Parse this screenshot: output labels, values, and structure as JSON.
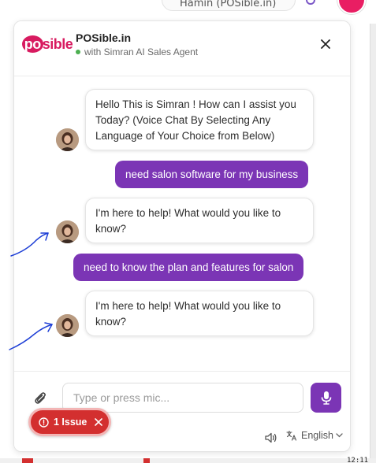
{
  "background": {
    "topbar_text": "Hamin (POSible.in)"
  },
  "header": {
    "logo_po": "po",
    "logo_sible": "sible",
    "title": "POSible.in",
    "subtitle": "with Simran AI Sales Agent",
    "close_icon": "close-icon"
  },
  "messages": [
    {
      "role": "bot",
      "text": "Hello This is Simran ! How can I assist you Today? (Voice Chat By Selecting Any Language of Your Choice from Below)"
    },
    {
      "role": "user",
      "text": "need salon software for my business"
    },
    {
      "role": "bot",
      "text": "I'm here to help! What would you like to know?"
    },
    {
      "role": "user",
      "text": "need to know the plan and features for salon"
    },
    {
      "role": "bot",
      "text": "I'm here to help! What would you like to know?"
    }
  ],
  "composer": {
    "placeholder": "Type or press mic...",
    "value": "",
    "attach_icon": "paperclip-icon",
    "mic_icon": "microphone-icon"
  },
  "footer": {
    "speaker_icon": "speaker-icon",
    "language_icon": "translate-icon",
    "language": "English"
  },
  "issue_badge": {
    "label": "1 Issue"
  },
  "clock": "12:11",
  "colors": {
    "accent": "#7b35b5",
    "brand": "#d81b60",
    "online": "#4caf50",
    "issue": "#d32f2f",
    "annotation": "#1e3fd6"
  }
}
